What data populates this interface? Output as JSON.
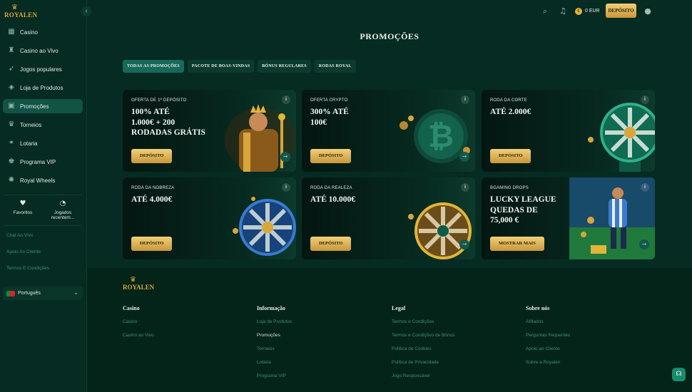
{
  "brand": {
    "name": "ROYALEN"
  },
  "sidebar": {
    "items": [
      {
        "label": "Casino",
        "icon": "casino-icon",
        "glyph": "▦"
      },
      {
        "label": "Casino ao Vivo",
        "icon": "live-casino-icon",
        "glyph": "♜"
      },
      {
        "label": "Jogos populares",
        "icon": "rocket-icon",
        "glyph": "➶"
      },
      {
        "label": "Loja de Produtos",
        "icon": "tag-icon",
        "glyph": "◈"
      },
      {
        "label": "Promoções",
        "icon": "gift-icon",
        "glyph": "▣"
      },
      {
        "label": "Torneios",
        "icon": "trophy-icon",
        "glyph": "♛"
      },
      {
        "label": "Lotaria",
        "icon": "lottery-icon",
        "glyph": "⚭"
      },
      {
        "label": "Programa VIP",
        "icon": "crown-icon",
        "glyph": "♚"
      },
      {
        "label": "Royal Wheels",
        "icon": "wheel-icon",
        "glyph": "✺"
      }
    ],
    "active_index": 4,
    "quick": {
      "favorites": "Favoritos",
      "recent": "Jogados recentem..."
    },
    "links": [
      "Chat Ao Vivo",
      "Apoio Ao Cliente",
      "Termos E Condições"
    ],
    "language": "Português"
  },
  "topbar": {
    "balance": "0 EUR",
    "coin_symbol": "€",
    "deposit_label": "DEPÓSITO"
  },
  "main": {
    "title": "PROMOÇÕES",
    "tabs": [
      "TODAS AS PROMOÇÕES",
      "PACOTE DE BOAS-VINDAS",
      "BÓNUS REGULARES",
      "RODAS ROYAL"
    ],
    "cards": [
      {
        "label": "OFERTA DE 1º DEPÓSITO",
        "headline": "100% ATÉ\n1.000€ + 200\nRODADAS GRÁTIS",
        "cta": "DEPÓSITO"
      },
      {
        "label": "OFERTA CRYPTO",
        "headline": "300% ATÉ\n100€",
        "cta": "DEPÓSITO"
      },
      {
        "label": "RODA DA CORTE",
        "headline": "ATÉ 2.000€",
        "cta": "DEPÓSITO"
      },
      {
        "label": "RODA DA NOBREZA",
        "headline": "ATÉ 4.000€",
        "cta": "DEPÓSITO"
      },
      {
        "label": "RODA DA REALEZA",
        "headline": "ATÉ 10.000€",
        "cta": "DEPÓSITO"
      },
      {
        "label": "BGAMING DROPS",
        "headline": "LUCKY LEAGUE\nQUEDAS DE\n75,000 €",
        "cta": "MOSTRAR MAIS"
      }
    ]
  },
  "footer": {
    "columns": [
      {
        "title": "Casino",
        "links": [
          "Casino",
          "Casino ao Vivo"
        ]
      },
      {
        "title": "Informação",
        "links": [
          "Loja de Produtos",
          "Promoções",
          "Torneios",
          "Lotaria",
          "Programa VIP"
        ]
      },
      {
        "title": "Legal",
        "links": [
          "Termos e Condições",
          "Termos e Condições de Bónus",
          "Política de Cookies",
          "Política de Privacidade",
          "Jogo Responsável"
        ]
      },
      {
        "title": "Sobre nós",
        "links": [
          "Afiliados",
          "Perguntas frequentes",
          "Apoio ao Cliente",
          "Sobre a Royalen"
        ]
      }
    ]
  },
  "colors": {
    "background": "#062b22",
    "accent": "#115446",
    "gold": "#d8a63a",
    "link": "#3f8f74"
  }
}
